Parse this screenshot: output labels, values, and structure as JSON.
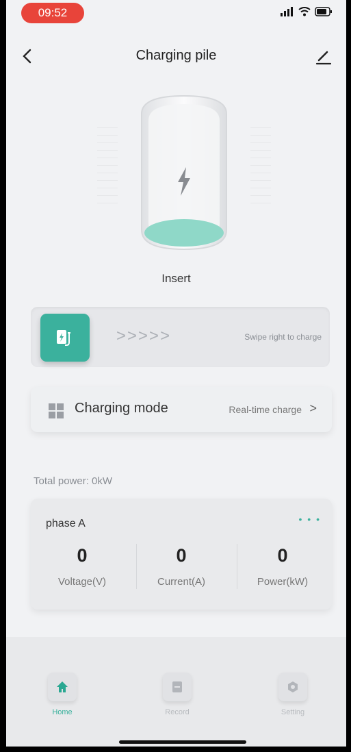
{
  "status_bar": {
    "time": "09:52"
  },
  "nav": {
    "title": "Charging pile"
  },
  "charger": {
    "state": "Insert"
  },
  "swipe": {
    "hint": "Swipe right to charge",
    "arrows": ">>>>>"
  },
  "mode": {
    "label": "Charging mode",
    "value": "Real-time charge",
    "chevron": ">"
  },
  "total_power": "Total power:  0kW",
  "phase": {
    "title": "phase A",
    "more": "• • •",
    "metrics": [
      {
        "value": "0",
        "label": "Voltage(V)"
      },
      {
        "value": "0",
        "label": "Current(A)"
      },
      {
        "value": "0",
        "label": "Power(kW)"
      }
    ]
  },
  "tabs": [
    {
      "label": "Home",
      "icon": "home-icon",
      "active": true
    },
    {
      "label": "Record",
      "icon": "record-icon",
      "active": false
    },
    {
      "label": "Setting",
      "icon": "setting-icon",
      "active": false
    }
  ],
  "colors": {
    "accent": "#3bb19d",
    "status_pill": "#e8443a"
  }
}
